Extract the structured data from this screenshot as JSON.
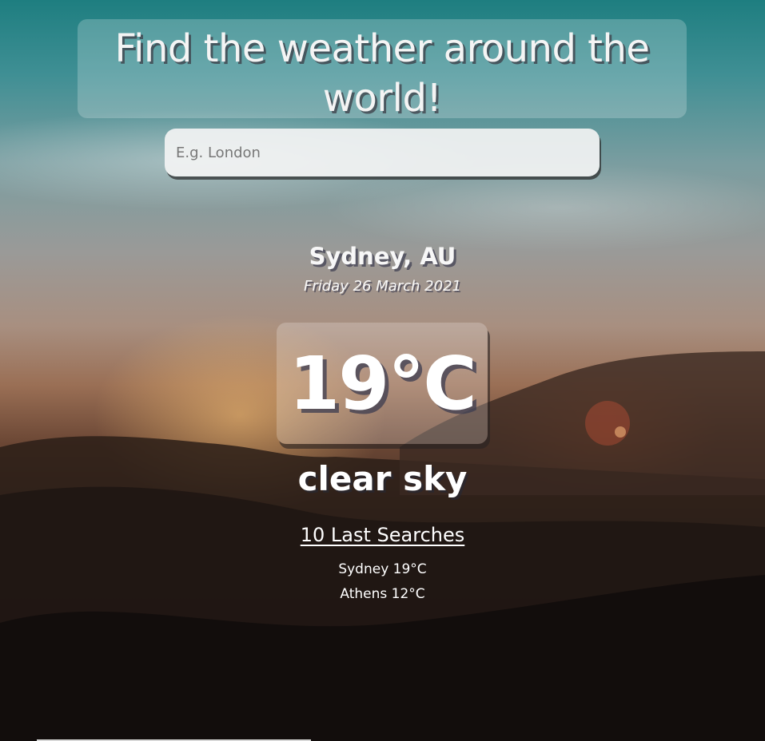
{
  "hero": {
    "title": "Find the weather around the world!"
  },
  "search": {
    "placeholder": "E.g. London",
    "value": ""
  },
  "weather": {
    "location": "Sydney, AU",
    "date": "Friday 26 March 2021",
    "temperature": "19°C",
    "condition": "clear sky"
  },
  "history": {
    "title": "10 Last Searches",
    "items": [
      {
        "label": "Sydney 19°C"
      },
      {
        "label": "Athens 12°C"
      }
    ]
  }
}
